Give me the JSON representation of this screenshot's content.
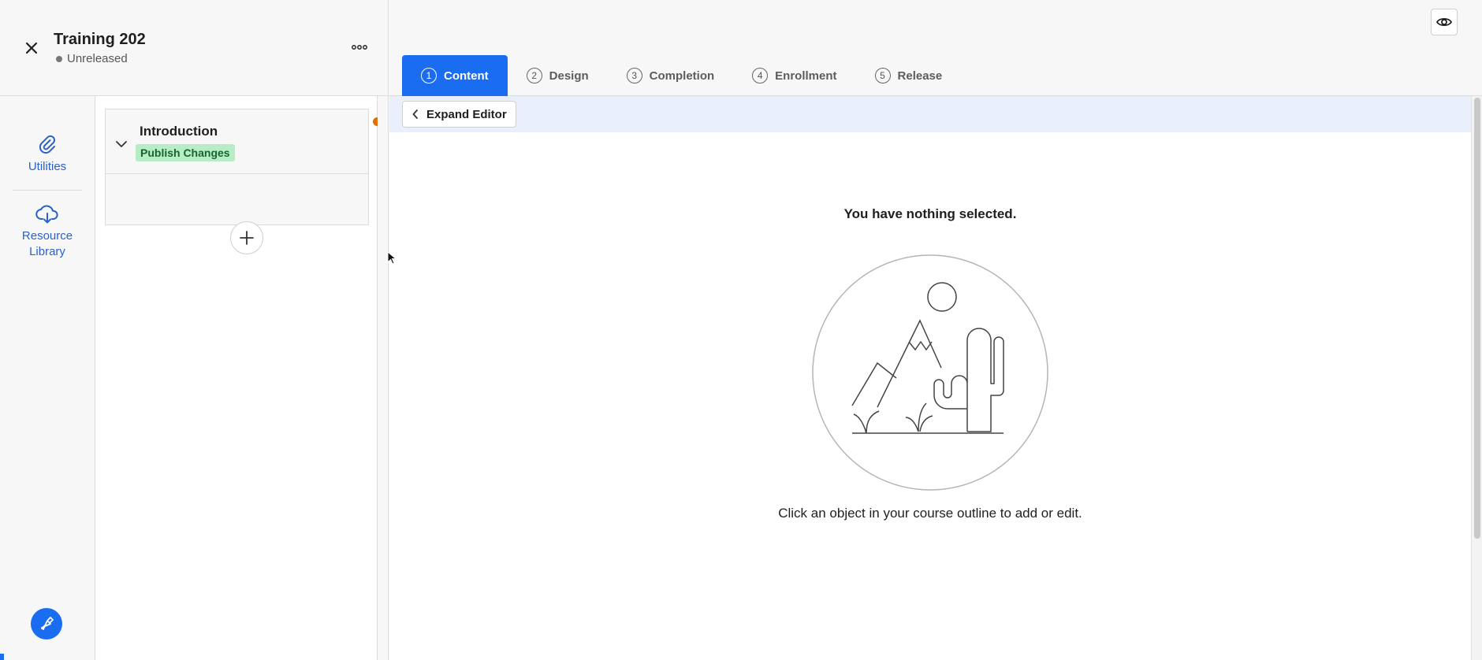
{
  "course": {
    "title": "Training 202",
    "status": "Unreleased"
  },
  "tabs": [
    {
      "num": "1",
      "label": "Content",
      "active": true
    },
    {
      "num": "2",
      "label": "Design",
      "active": false
    },
    {
      "num": "3",
      "label": "Completion",
      "active": false
    },
    {
      "num": "4",
      "label": "Enrollment",
      "active": false
    },
    {
      "num": "5",
      "label": "Release",
      "active": false
    }
  ],
  "rail": {
    "items": [
      {
        "label": "Utilities",
        "icon": "paperclip-icon"
      },
      {
        "label": "Resource Library",
        "icon": "cloud-download-icon"
      }
    ],
    "assist_icon": "rocket-pen-icon"
  },
  "outline": {
    "sections": [
      {
        "title": "Introduction",
        "badge": "Publish Changes",
        "has_unpublished_changes": true
      }
    ]
  },
  "editor": {
    "expand_label": "Expand Editor",
    "empty_title": "You have nothing selected.",
    "empty_hint": "Click an object in your course outline to add or edit."
  },
  "colors": {
    "primary": "#1a6cf0",
    "link": "#2a62c9",
    "badge_bg": "#b7ecc6",
    "badge_text": "#15652d",
    "change_dot": "#e07000"
  }
}
